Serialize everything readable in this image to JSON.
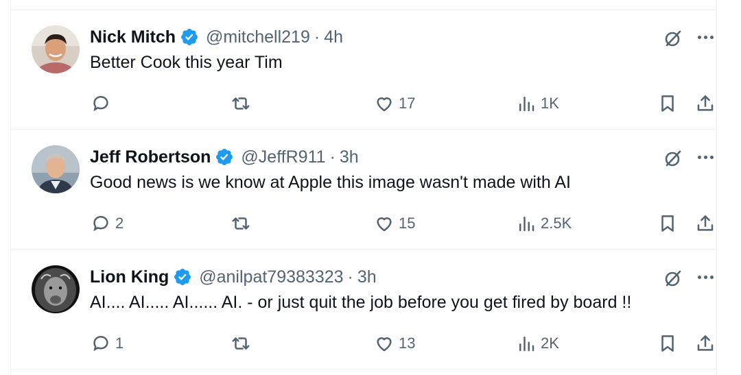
{
  "tweets": [
    {
      "name": "Nick Mitch",
      "handle": "@mitchell219",
      "separator": "·",
      "time": "4h",
      "text": "Better Cook this year Tim",
      "replies": "",
      "likes": "17",
      "views": "1K"
    },
    {
      "name": "Jeff Robertson",
      "handle": "@JeffR911",
      "separator": "·",
      "time": "3h",
      "text": "Good news is we know at Apple this image wasn't made with AI",
      "replies": "2",
      "likes": "15",
      "views": "2.5K"
    },
    {
      "name": "Lion King",
      "handle": "@anilpat79383323",
      "separator": "·",
      "time": "3h",
      "text": "AI.... AI..... AI...... AI.  - or just quit the job before you get fired by board !!",
      "replies": "1",
      "likes": "13",
      "views": "2K"
    }
  ],
  "colors": {
    "text_primary": "#0f1419",
    "text_secondary": "#536471",
    "verified_blue": "#1d9bf0",
    "divider": "#eff3f4"
  },
  "icons": [
    "verified-badge-icon",
    "grok-icon",
    "more-icon",
    "reply-icon",
    "retweet-icon",
    "like-icon",
    "views-icon",
    "bookmark-icon",
    "share-icon"
  ]
}
